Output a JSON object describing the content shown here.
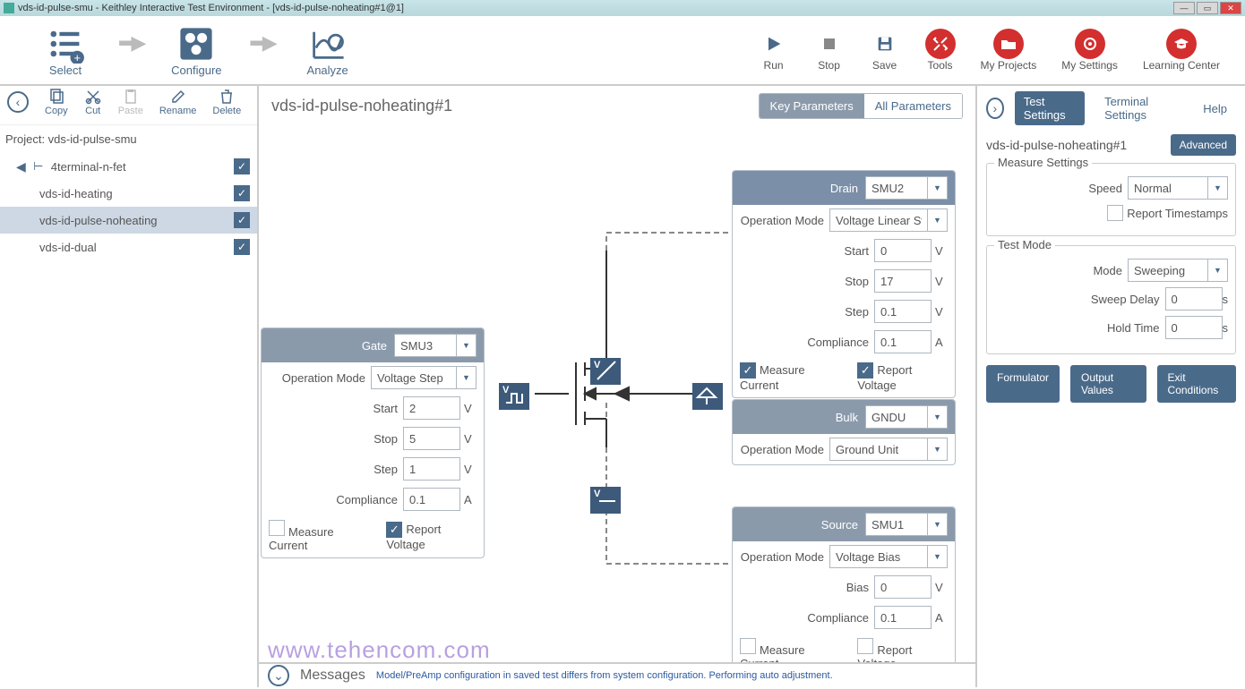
{
  "window": {
    "title": "vds-id-pulse-smu - Keithley Interactive Test Environment - [vds-id-pulse-noheating#1@1]"
  },
  "steps": {
    "select": "Select",
    "configure": "Configure",
    "analyze": "Analyze"
  },
  "top": {
    "run": "Run",
    "stop": "Stop",
    "save": "Save",
    "tools": "Tools",
    "myprojects": "My Projects",
    "mysettings": "My Settings",
    "learning": "Learning Center"
  },
  "edit": {
    "copy": "Copy",
    "cut": "Cut",
    "paste": "Paste",
    "rename": "Rename",
    "delete": "Delete"
  },
  "project": {
    "label": "Project: vds-id-pulse-smu",
    "root": "4terminal-n-fet",
    "children": [
      "vds-id-heating",
      "vds-id-pulse-noheating",
      "vds-id-dual"
    ]
  },
  "center": {
    "title": "vds-id-pulse-noheating#1",
    "tab_key": "Key Parameters",
    "tab_all": "All Parameters"
  },
  "drain": {
    "label": "Drain",
    "smu": "SMU2",
    "opmode_l": "Operation Mode",
    "opmode": "Voltage Linear Sweep",
    "start_l": "Start",
    "start": "0",
    "stop_l": "Stop",
    "stop": "17",
    "step_l": "Step",
    "step": "0.1",
    "comp_l": "Compliance",
    "comp": "0.1",
    "unit_v": "V",
    "unit_a": "A",
    "mc": "Measure Current",
    "rv": "Report Voltage"
  },
  "gate": {
    "label": "Gate",
    "smu": "SMU3",
    "opmode_l": "Operation Mode",
    "opmode": "Voltage Step",
    "start_l": "Start",
    "start": "2",
    "stop_l": "Stop",
    "stop": "5",
    "step_l": "Step",
    "step": "1",
    "comp_l": "Compliance",
    "comp": "0.1",
    "unit_v": "V",
    "unit_a": "A",
    "mc": "Measure Current",
    "rv": "Report Voltage"
  },
  "bulk": {
    "label": "Bulk",
    "smu": "GNDU",
    "opmode_l": "Operation Mode",
    "opmode": "Ground Unit"
  },
  "source": {
    "label": "Source",
    "smu": "SMU1",
    "opmode_l": "Operation Mode",
    "opmode": "Voltage Bias",
    "bias_l": "Bias",
    "bias": "0",
    "comp_l": "Compliance",
    "comp": "0.1",
    "unit_v": "V",
    "unit_a": "A",
    "mc": "Measure Current",
    "rv": "Report Voltage"
  },
  "right": {
    "tab_test": "Test Settings",
    "tab_term": "Terminal Settings",
    "tab_help": "Help",
    "title": "vds-id-pulse-noheating#1",
    "advanced": "Advanced",
    "ms_legend": "Measure Settings",
    "speed_l": "Speed",
    "speed": "Normal",
    "report_ts": "Report Timestamps",
    "tm_legend": "Test Mode",
    "mode_l": "Mode",
    "mode": "Sweeping",
    "sweep_l": "Sweep Delay",
    "sweep": "0",
    "hold_l": "Hold Time",
    "hold": "0",
    "unit_s": "s",
    "formulator": "Formulator",
    "output": "Output Values",
    "exit": "Exit Conditions"
  },
  "messages": {
    "label": "Messages",
    "text": "Model/PreAmp configuration in saved test differs from system configuration. Performing auto adjustment."
  },
  "watermark": "www.tehencom.com",
  "glyph": {
    "v": "V"
  }
}
